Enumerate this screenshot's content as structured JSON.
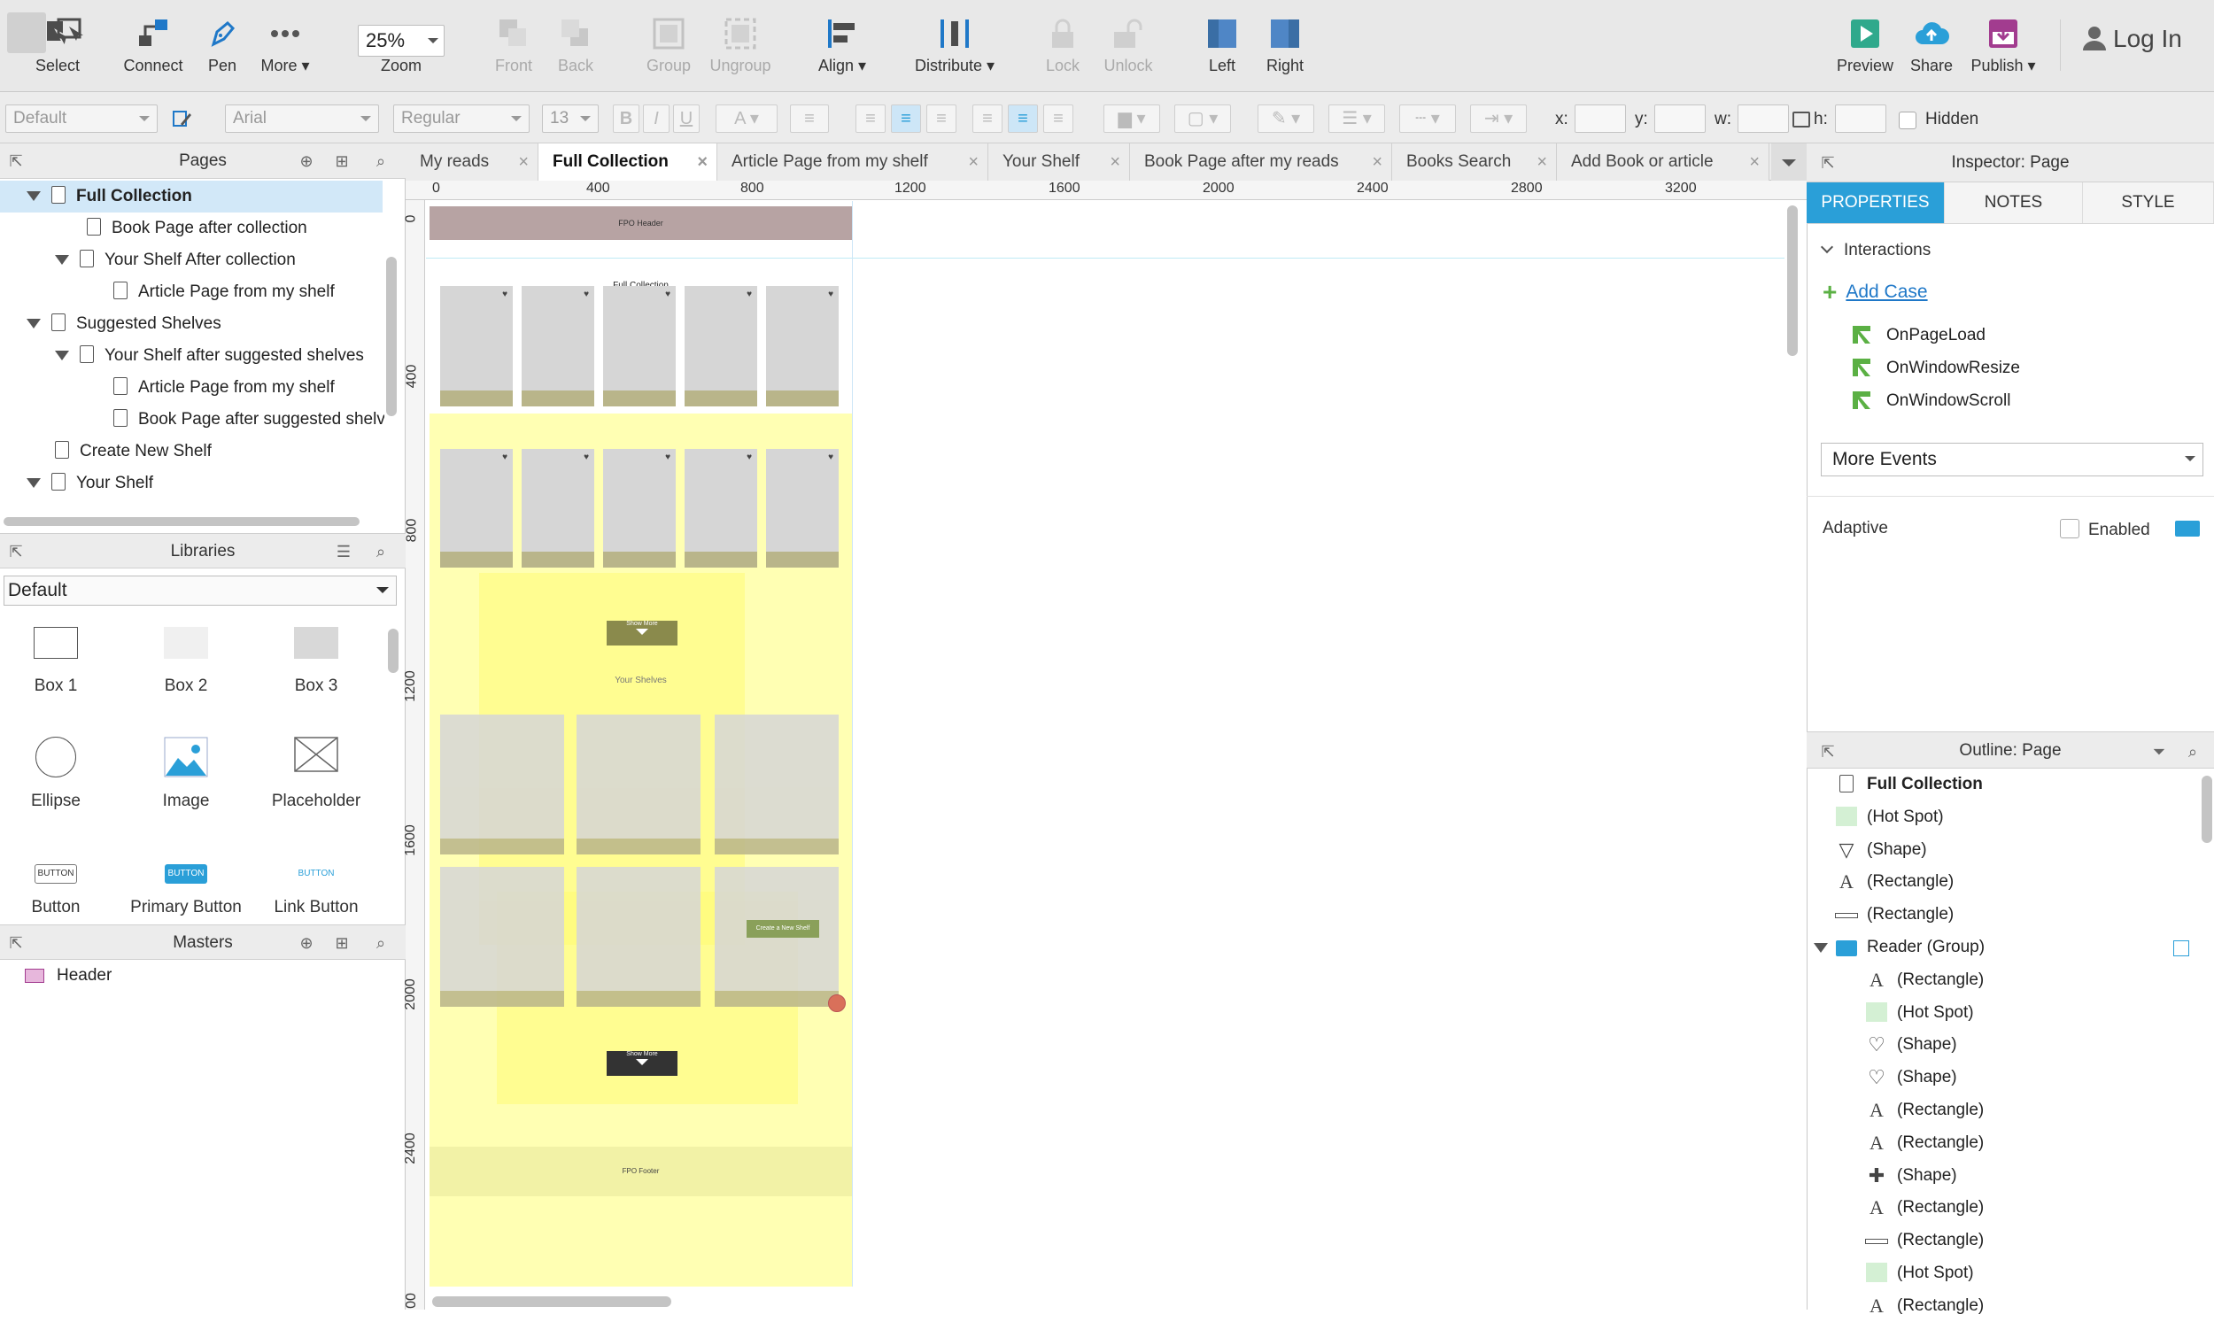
{
  "toolbar": {
    "select": "Select",
    "connect": "Connect",
    "pen": "Pen",
    "more": "More ▾",
    "zoom_value": "25%",
    "zoom": "Zoom",
    "front": "Front",
    "back": "Back",
    "group": "Group",
    "ungroup": "Ungroup",
    "align": "Align ▾",
    "distribute": "Distribute ▾",
    "lock": "Lock",
    "unlock": "Unlock",
    "left": "Left",
    "right": "Right",
    "preview": "Preview",
    "share": "Share",
    "publish": "Publish ▾",
    "login": "Log In"
  },
  "format": {
    "style": "Default",
    "font": "Arial",
    "weight": "Regular",
    "size": "13",
    "x_label": "x:",
    "y_label": "y:",
    "w_label": "w:",
    "h_label": "h:",
    "hidden": "Hidden"
  },
  "pages": {
    "title": "Pages",
    "items": [
      {
        "label": "Full Collection"
      },
      {
        "label": "Book Page after collection"
      },
      {
        "label": "Your Shelf After collection"
      },
      {
        "label": "Article Page from my shelf"
      },
      {
        "label": "Suggested Shelves"
      },
      {
        "label": "Your Shelf after suggested shelves"
      },
      {
        "label": "Article Page from my shelf"
      },
      {
        "label": "Book Page after suggested shelves"
      },
      {
        "label": "Create New Shelf"
      },
      {
        "label": "Your Shelf"
      }
    ]
  },
  "libraries": {
    "title": "Libraries",
    "selected": "Default",
    "items": [
      "Box 1",
      "Box 2",
      "Box 3",
      "Ellipse",
      "Image",
      "Placeholder",
      "Button",
      "Primary Button",
      "Link Button"
    ],
    "button_text": "BUTTON"
  },
  "masters": {
    "title": "Masters",
    "items": [
      "Header"
    ]
  },
  "tabs": [
    {
      "label": "My reads"
    },
    {
      "label": "Full Collection"
    },
    {
      "label": "Article Page from my shelf"
    },
    {
      "label": "Your Shelf"
    },
    {
      "label": "Book Page after my reads"
    },
    {
      "label": "Books Search"
    },
    {
      "label": "Add Book or article"
    }
  ],
  "ruler": {
    "h": [
      "0",
      "400",
      "800",
      "1200",
      "1600",
      "2000",
      "2400",
      "2800",
      "3200"
    ],
    "v": [
      "0",
      "400",
      "800",
      "1200",
      "1600",
      "2000",
      "2400",
      "00"
    ]
  },
  "canvas": {
    "header": "FPO Header",
    "title": "Full Collection",
    "show_more": "Show More",
    "your_shelves": "Your Shelves",
    "create_shelf": "Create a New Shelf",
    "footer": "FPO Footer"
  },
  "inspector": {
    "title": "Inspector: Page",
    "tabs": [
      "PROPERTIES",
      "NOTES",
      "STYLE"
    ],
    "interactions": "Interactions",
    "add_case": "Add Case",
    "events": [
      "OnPageLoad",
      "OnWindowResize",
      "OnWindowScroll"
    ],
    "more_events": "More Events",
    "adaptive": "Adaptive",
    "enabled": "Enabled"
  },
  "outline": {
    "title": "Outline: Page",
    "items": [
      {
        "label": "Full Collection",
        "icon": "page"
      },
      {
        "label": "(Hot Spot)",
        "icon": "hotspot"
      },
      {
        "label": "(Shape)",
        "icon": "triangle"
      },
      {
        "label": "(Rectangle)",
        "icon": "text"
      },
      {
        "label": "(Rectangle)",
        "icon": "line"
      },
      {
        "label": "Reader (Group)",
        "icon": "folder"
      },
      {
        "label": "(Rectangle)",
        "icon": "text"
      },
      {
        "label": "(Hot Spot)",
        "icon": "hotspot"
      },
      {
        "label": "(Shape)",
        "icon": "heart"
      },
      {
        "label": "(Shape)",
        "icon": "heart"
      },
      {
        "label": "(Rectangle)",
        "icon": "text"
      },
      {
        "label": "(Rectangle)",
        "icon": "text"
      },
      {
        "label": "(Shape)",
        "icon": "cross"
      },
      {
        "label": "(Rectangle)",
        "icon": "text"
      },
      {
        "label": "(Rectangle)",
        "icon": "line"
      },
      {
        "label": "(Hot Spot)",
        "icon": "hotspot"
      },
      {
        "label": "(Rectangle)",
        "icon": "text"
      }
    ]
  },
  "colors": {
    "accent": "#2a9fd8",
    "link": "#1f78c8",
    "highlight": "#ffff9a"
  }
}
